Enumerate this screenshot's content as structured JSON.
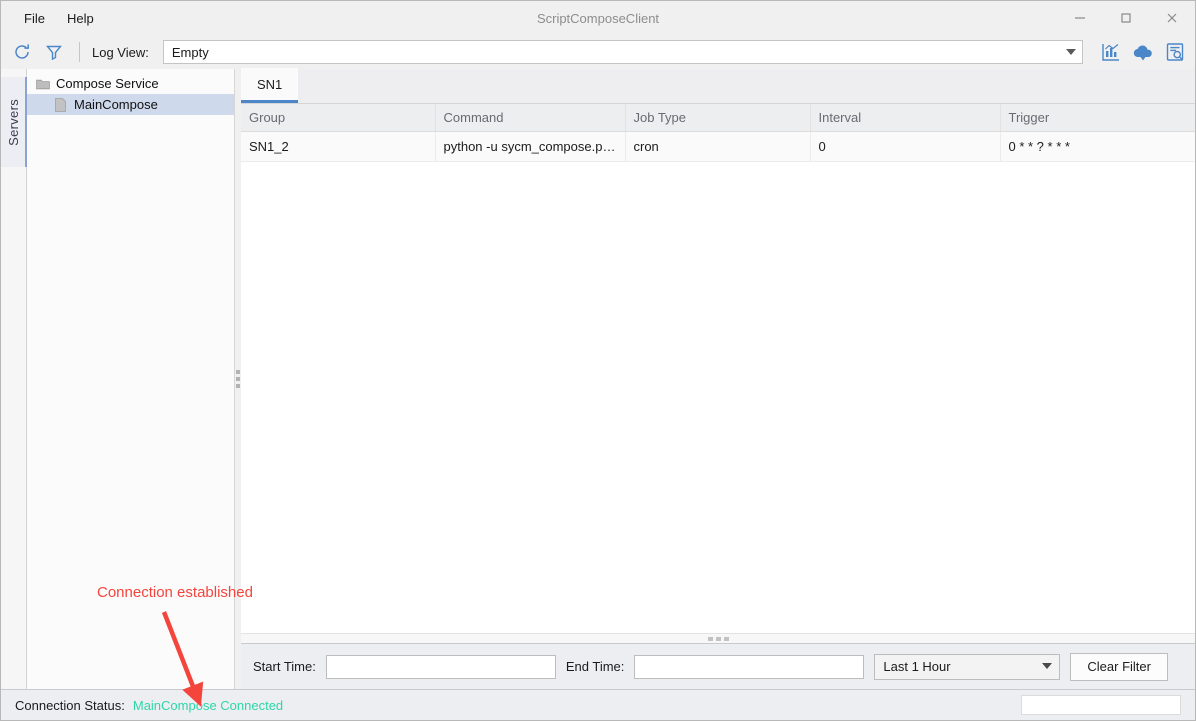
{
  "window": {
    "title": "ScriptComposeClient",
    "controls": {
      "minimize": "minimize-icon",
      "maximize": "maximize-icon",
      "close": "close-icon"
    }
  },
  "menubar": {
    "items": [
      {
        "label": "File"
      },
      {
        "label": "Help"
      }
    ]
  },
  "toolbar": {
    "refresh_icon": "refresh-icon",
    "filter_icon": "filter-funnel-icon",
    "log_view_label": "Log View:",
    "log_view_value": "Empty",
    "log_view_placeholder": "Empty",
    "right_icons": [
      {
        "name": "statistics-chart-icon"
      },
      {
        "name": "cloud-download-icon"
      },
      {
        "name": "document-search-icon"
      }
    ]
  },
  "sidebar": {
    "tab_label": "Servers",
    "tree": [
      {
        "label": "Compose Service",
        "icon": "folder-icon",
        "level": 0,
        "selected": false
      },
      {
        "label": "MainCompose",
        "icon": "file-icon",
        "level": 1,
        "selected": true
      }
    ]
  },
  "main": {
    "tabs": [
      {
        "label": "SN1",
        "active": true
      }
    ],
    "table": {
      "columns": [
        "Group",
        "Command",
        "Job Type",
        "Interval",
        "Trigger"
      ],
      "rows": [
        {
          "group": "SN1_2",
          "command": "python -u sycm_compose.py...",
          "job_type": "cron",
          "interval": "0",
          "trigger": "0 * * ? * * *"
        }
      ]
    }
  },
  "filterbar": {
    "start_time_label": "Start Time:",
    "start_time_value": "",
    "end_time_label": "End Time:",
    "end_time_value": "",
    "range_value": "Last 1 Hour",
    "clear_filter_label": "Clear Filter"
  },
  "statusbar": {
    "label": "Connection Status:",
    "value": "MainCompose Connected",
    "value_color": "#2fd6a8",
    "field_value": ""
  },
  "annotation": {
    "text": "Connection established",
    "color": "#f4453c"
  }
}
